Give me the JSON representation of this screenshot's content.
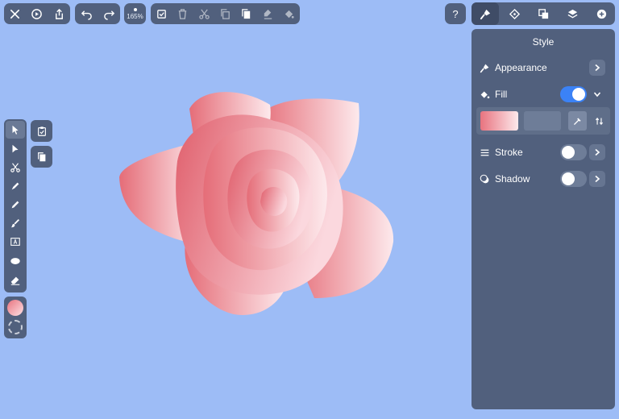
{
  "toolbar": {
    "file_icons": [
      "close-icon",
      "history-icon",
      "share-icon"
    ],
    "edit_icons": [
      "undo-icon",
      "redo-icon"
    ],
    "zoom_label": "165%",
    "action_icons": [
      "select-check-icon",
      "trash-icon",
      "scissors-icon",
      "copy-icon",
      "paste-icon",
      "paste-style-icon",
      "paint-bucket-icon"
    ],
    "help_label": "?",
    "panel_tabs": [
      "style-tab",
      "geometry-tab",
      "arrange-tab",
      "layers-tab",
      "add-tab"
    ]
  },
  "style_panel": {
    "title": "Style",
    "appearance": {
      "label": "Appearance"
    },
    "fill": {
      "label": "Fill",
      "enabled": true,
      "gradient_start": "#e8737f",
      "gradient_end": "#fde9ec"
    },
    "stroke": {
      "label": "Stroke",
      "enabled": false
    },
    "shadow": {
      "label": "Shadow",
      "enabled": false
    }
  },
  "tools": [
    "select-tool",
    "direct-select-tool",
    "scissors-tool",
    "pen-tool",
    "pencil-tool",
    "brush-tool",
    "text-tool",
    "ellipse-tool",
    "eraser-tool"
  ],
  "colors": {
    "accent": "#3b82f6",
    "panel": "#51607d",
    "canvas": "#9dbcf6",
    "petal_dark": "#e56d78",
    "petal_light": "#fde9ec"
  }
}
